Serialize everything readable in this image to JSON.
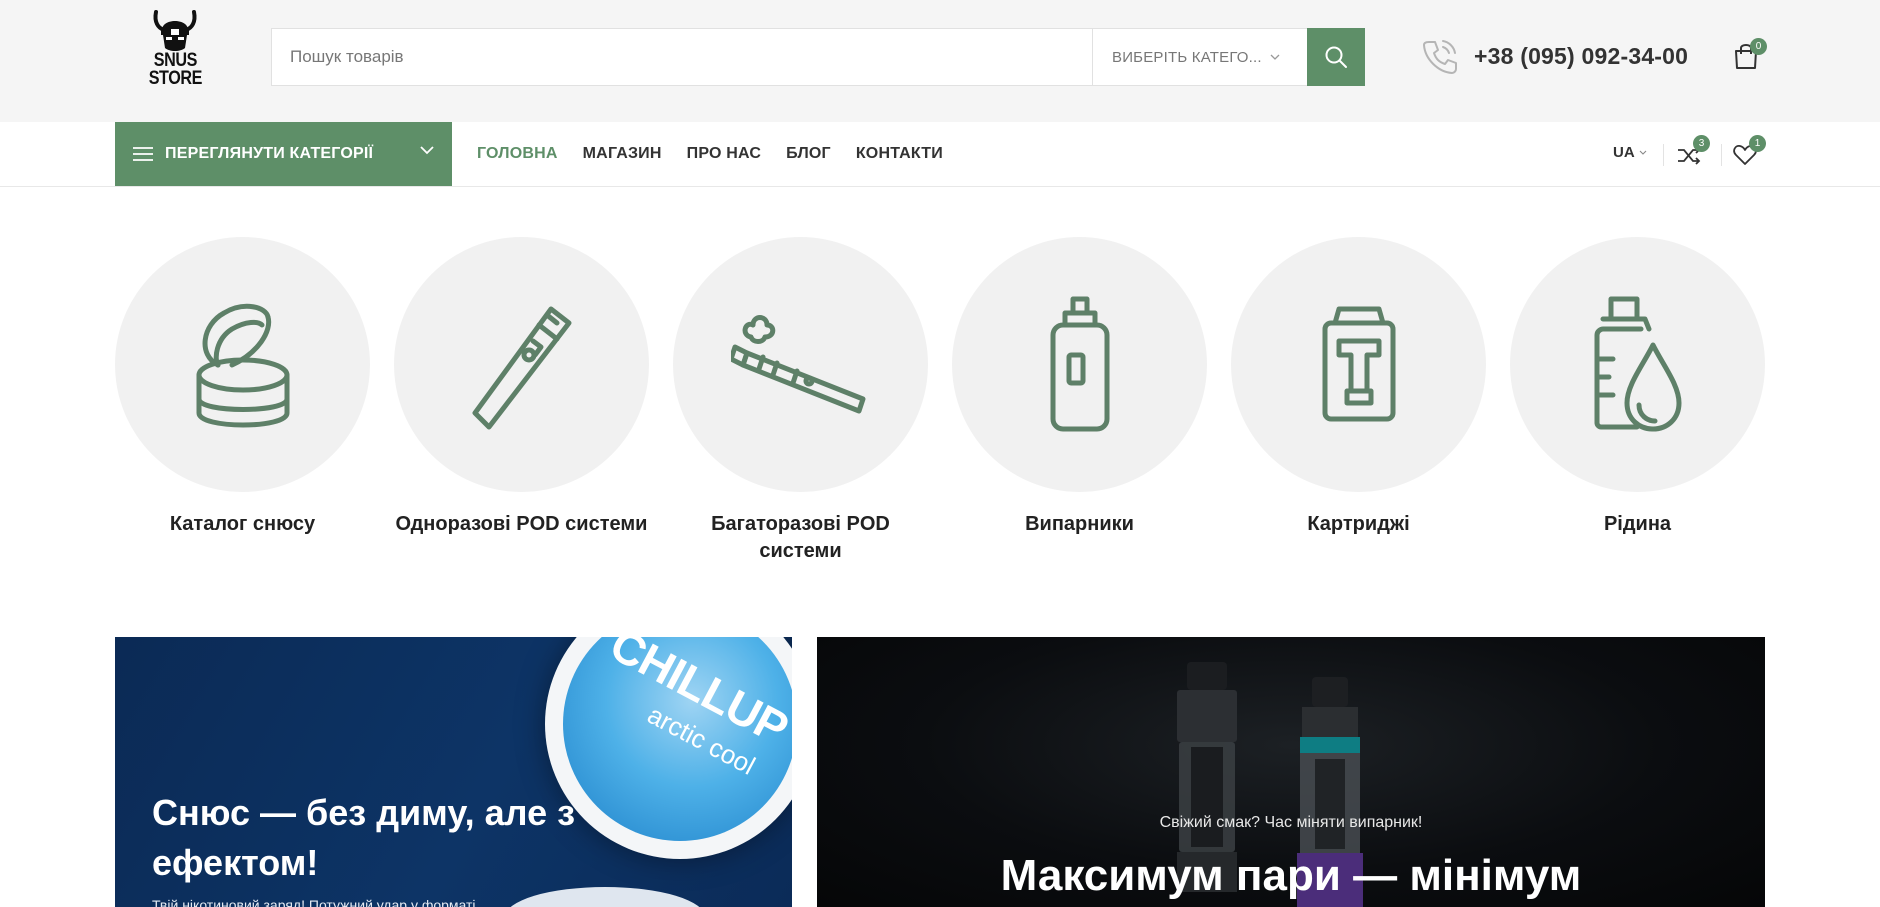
{
  "header": {
    "logo": {
      "line1": "SNUS",
      "line2": "STORE"
    },
    "search": {
      "placeholder": "Пошук товарів",
      "category_label": "ВИБЕРІТЬ КАТЕГО..."
    },
    "phone": "+38 (095) 092-34-00",
    "cart_count": "0"
  },
  "nav": {
    "categories_button": "ПЕРЕГЛЯНУТИ КАТЕГОРІЇ",
    "menu": [
      {
        "label": "ГОЛОВНА",
        "active": true
      },
      {
        "label": "МАГАЗИН"
      },
      {
        "label": "ПРО НАС"
      },
      {
        "label": "БЛОГ"
      },
      {
        "label": "КОНТАКТИ"
      }
    ],
    "language": "UA",
    "compare_count": "3",
    "wishlist_count": "1"
  },
  "categories": [
    {
      "label": "Каталог снюсу",
      "icon": "snus-tin-icon"
    },
    {
      "label": "Одноразові POD системи",
      "icon": "disposable-pod-icon"
    },
    {
      "label": "Багаторазові POD системи",
      "icon": "reusable-pod-icon"
    },
    {
      "label": "Випарники",
      "icon": "vaporizer-icon"
    },
    {
      "label": "Картриджі",
      "icon": "cartridge-icon"
    },
    {
      "label": "Рідина",
      "icon": "liquid-icon"
    }
  ],
  "banners": {
    "left": {
      "product_brand": "CHILLUP",
      "product_flavor": "arctic cool",
      "title": "Снюс — без диму, але з ефектом!",
      "text": "Твій нікотиновий заряд! Потужний удар у форматі..."
    },
    "right": {
      "subtitle": "Свіжий смак? Час міняти випарник!",
      "title": "Максимум пари — мінімум"
    }
  },
  "colors": {
    "accent": "#5e8f68",
    "header_bg": "#f5f5f5",
    "circle_bg": "#f1f1f1"
  }
}
